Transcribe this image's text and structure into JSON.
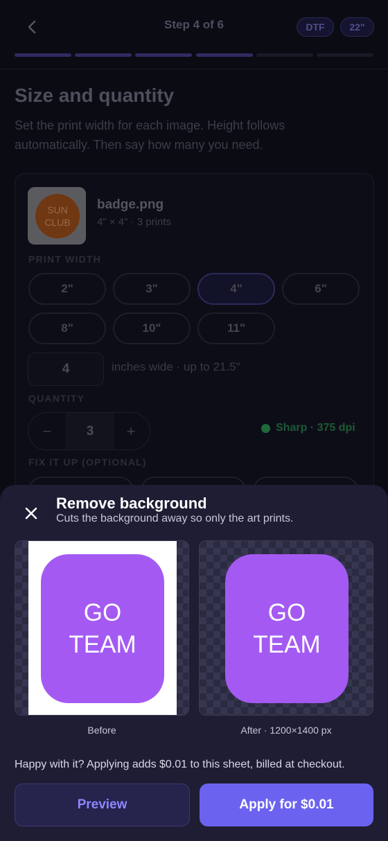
{
  "header": {
    "step": "Step 4 of 6",
    "badges": [
      "DTF",
      "22\""
    ],
    "progress": {
      "total": 6,
      "completed": 4
    }
  },
  "page": {
    "title": "Size and quantity",
    "subtitle": "Set the print width for each image. Height follows automatically. Then say how many you need."
  },
  "item": {
    "thumb_text": [
      "SUN",
      "CLUB"
    ],
    "file_name": "badge.png",
    "meta": "4\" × 4\" · 3 prints",
    "print_width_label": "PRINT WIDTH",
    "widths": [
      "2\"",
      "3\"",
      "4\"",
      "6\"",
      "8\"",
      "10\"",
      "11\""
    ],
    "selected_width": "4\"",
    "custom_width": "4",
    "custom_hint": "inches wide · up to 21.5\"",
    "quantity_label": "QUANTITY",
    "quantity": "3",
    "minus": "−",
    "plus": "+",
    "quality": "Sharp · 375 dpi",
    "fix_label": "FIX IT UP (OPTIONAL)"
  },
  "sheet": {
    "title": "Remove background",
    "subtitle": "Cuts the background away so only the art prints.",
    "art_text": [
      "GO",
      "TEAM"
    ],
    "before_label": "Before",
    "after_label": "After · 1200×1400 px",
    "note": "Happy with it? Applying adds $0.01 to this sheet, billed at checkout.",
    "preview_button": "Preview",
    "apply_button": "Apply for $0.01"
  },
  "colors": {
    "background": "#0b0b14",
    "sheet": "#1e1d34",
    "accent": "#6b63f0",
    "art": "#a45af2",
    "sharp": "#1f6a3a"
  }
}
